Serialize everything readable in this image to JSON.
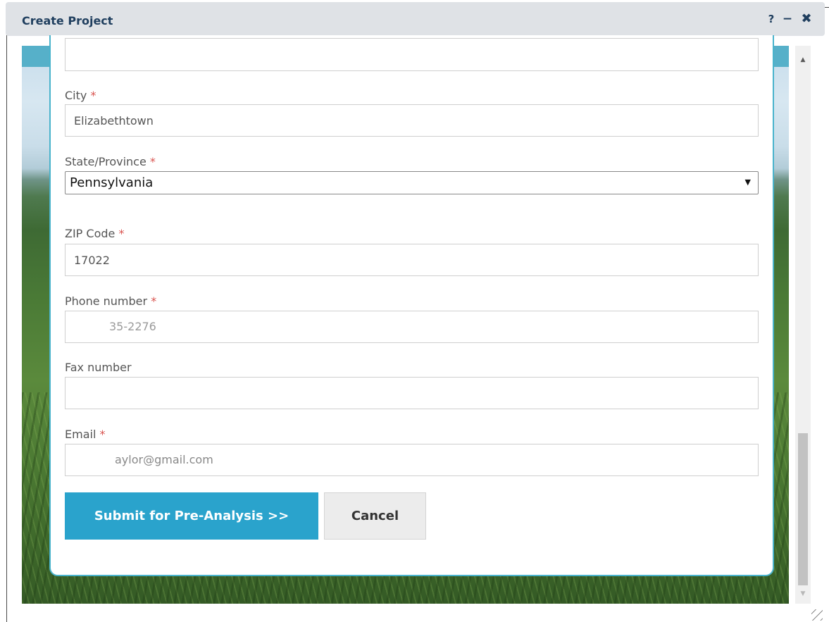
{
  "window": {
    "title": "Create Project",
    "help_label": "?",
    "minimize_label": "−",
    "close_label": "✖"
  },
  "scrollbar": {
    "up_label": "▲",
    "down_label": "▼"
  },
  "form": {
    "address2": {
      "value": ""
    },
    "city": {
      "label": "City",
      "required_mark": "*",
      "value": "Elizabethtown"
    },
    "state": {
      "label": "State/Province",
      "required_mark": "*",
      "value": "Pennsylvania",
      "arrow": "▼"
    },
    "zip": {
      "label": "ZIP Code",
      "required_mark": "*",
      "value": "17022"
    },
    "phone": {
      "label": "Phone number",
      "required_mark": "*",
      "value": "35-2276"
    },
    "fax": {
      "label": "Fax number",
      "value": ""
    },
    "email": {
      "label": "Email",
      "required_mark": "*",
      "value": "aylor@gmail.com"
    },
    "submit_label": "Submit for Pre-Analysis >>",
    "cancel_label": "Cancel"
  },
  "colors": {
    "title_text": "#1f3e5e",
    "accent": "#2aa3cc",
    "required": "#d9534f"
  }
}
